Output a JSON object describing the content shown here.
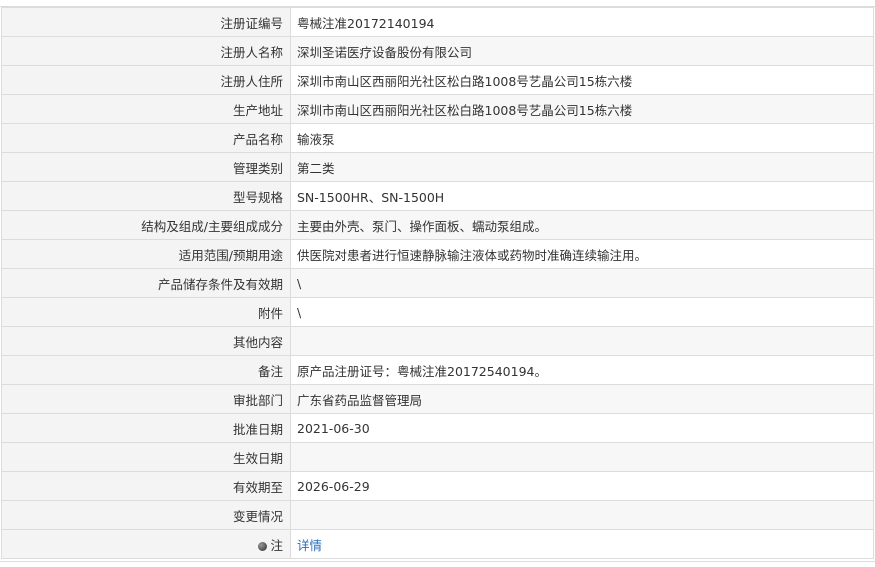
{
  "rows": [
    {
      "label": "注册证编号",
      "value": "粤械注准20172140194"
    },
    {
      "label": "注册人名称",
      "value": "深圳圣诺医疗设备股份有限公司"
    },
    {
      "label": "注册人住所",
      "value": "深圳市南山区西丽阳光社区松白路1008号艺晶公司15栋六楼"
    },
    {
      "label": "生产地址",
      "value": "深圳市南山区西丽阳光社区松白路1008号艺晶公司15栋六楼"
    },
    {
      "label": "产品名称",
      "value": "输液泵"
    },
    {
      "label": "管理类别",
      "value": "第二类"
    },
    {
      "label": "型号规格",
      "value": "SN-1500HR、SN-1500H"
    },
    {
      "label": "结构及组成/主要组成成分",
      "value": "主要由外壳、泵门、操作面板、蠕动泵组成。"
    },
    {
      "label": "适用范围/预期用途",
      "value": "供医院对患者进行恒速静脉输注液体或药物时准确连续输注用。"
    },
    {
      "label": "产品储存条件及有效期",
      "value": "\\"
    },
    {
      "label": "附件",
      "value": "\\"
    },
    {
      "label": "其他内容",
      "value": ""
    },
    {
      "label": "备注",
      "value": "原产品注册证号：粤械注准20172540194。"
    },
    {
      "label": "审批部门",
      "value": "广东省药品监督管理局"
    },
    {
      "label": "批准日期",
      "value": "2021-06-30"
    },
    {
      "label": "生效日期",
      "value": ""
    },
    {
      "label": "有效期至",
      "value": "2026-06-29"
    },
    {
      "label": "变更情况",
      "value": ""
    }
  ],
  "note_row": {
    "label": "注",
    "icon": "note-bullet-icon",
    "link_text": "详情"
  }
}
